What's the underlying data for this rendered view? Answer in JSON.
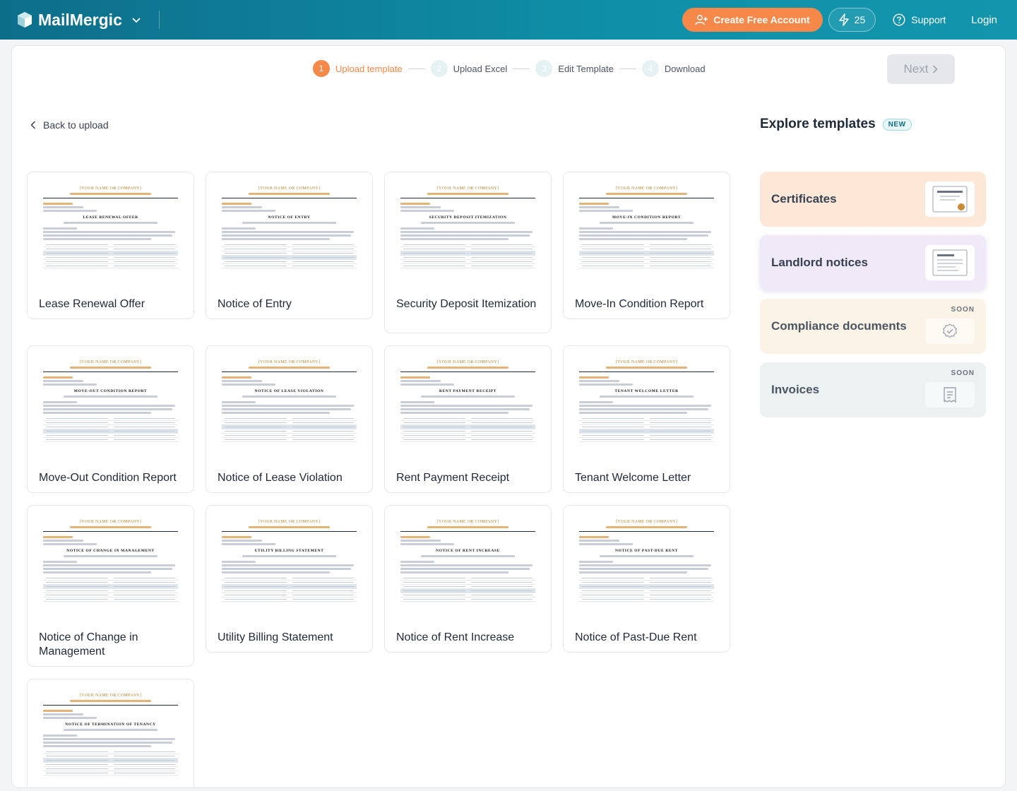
{
  "brand": {
    "name": "MailMergic"
  },
  "header": {
    "create_account": "Create Free Account",
    "credits": "25",
    "support": "Support",
    "login": "Login"
  },
  "stepper": [
    {
      "num": "1",
      "label": "Upload template",
      "active": true
    },
    {
      "num": "2",
      "label": "Upload Excel",
      "active": false
    },
    {
      "num": "3",
      "label": "Edit Template",
      "active": false
    },
    {
      "num": "4",
      "label": "Download",
      "active": false
    }
  ],
  "next_label": "Next",
  "back_label": "Back to upload",
  "explore": {
    "title": "Explore templates",
    "badge": "NEW"
  },
  "doc": {
    "company": "[YOUR NAME OR COMPANY]"
  },
  "templates": [
    {
      "title": "Lease Renewal Offer",
      "doc_heading": "LEASE RENEWAL OFFER"
    },
    {
      "title": "Notice of Entry",
      "doc_heading": "NOTICE OF ENTRY"
    },
    {
      "title": "Security Deposit Itemization",
      "doc_heading": "SECURITY DEPOSIT ITEMIZATION"
    },
    {
      "title": "Move-In Condition Report",
      "doc_heading": "MOVE-IN CONDITION REPORT"
    },
    {
      "title": "Move-Out Condition Report",
      "doc_heading": "MOVE-OUT CONDITION REPORT"
    },
    {
      "title": "Notice of Lease Violation",
      "doc_heading": "NOTICE OF LEASE VIOLATION"
    },
    {
      "title": "Rent Payment Receipt",
      "doc_heading": "RENT PAYMENT RECEIPT"
    },
    {
      "title": "Tenant Welcome Letter",
      "doc_heading": "TENANT WELCOME LETTER"
    },
    {
      "title": "Notice of Change in Management",
      "doc_heading": "NOTICE OF CHANGE IN MANAGEMENT"
    },
    {
      "title": "Utility Billing Statement",
      "doc_heading": "UTILITY BILLING STATEMENT"
    },
    {
      "title": "Notice of Rent Increase",
      "doc_heading": "NOTICE OF RENT INCREASE"
    },
    {
      "title": "Notice of Past-Due Rent",
      "doc_heading": "NOTICE OF PAST-DUE RENT"
    },
    {
      "title": "",
      "doc_heading": "NOTICE OF TERMINATION OF TENANCY"
    }
  ],
  "categories": [
    {
      "label": "Certificates",
      "bg": "#fde8d7",
      "soon": "",
      "icon": "certificate-icon"
    },
    {
      "label": "Landlord notices",
      "bg": "#efe9f8",
      "soon": "",
      "icon": "document-icon"
    },
    {
      "label": "Compliance documents",
      "bg": "#fbf3e6",
      "soon": "SOON",
      "icon": "check-badge-icon"
    },
    {
      "label": "Invoices",
      "bg": "#ecf1f2",
      "soon": "SOON",
      "icon": "receipt-icon"
    }
  ],
  "colors": {
    "accent": "#f6894a",
    "header": "#0f8fa8"
  }
}
